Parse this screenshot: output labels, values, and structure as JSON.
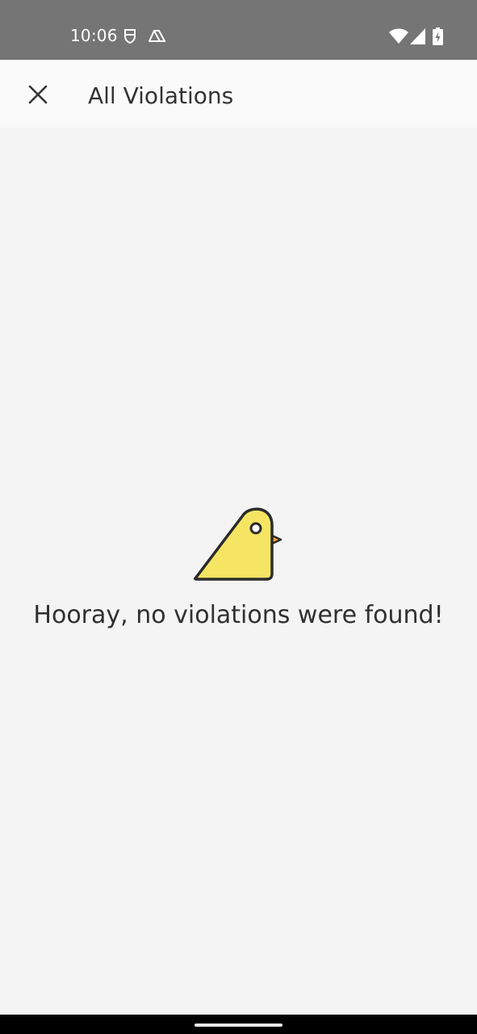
{
  "status_bar": {
    "time": "10:06",
    "notification_icons": [
      "shield-icon",
      "drive-icon"
    ],
    "system_icons": [
      "wifi-icon",
      "cellular-signal-icon",
      "battery-charging-icon"
    ]
  },
  "app_bar": {
    "close_icon": "close-icon",
    "title": "All Violations"
  },
  "empty_state": {
    "illustration": "bird-icon",
    "message": "Hooray, no violations were found!"
  },
  "colors": {
    "status_bar_bg": "#757575",
    "app_bar_bg": "#fafafa",
    "content_bg": "#f4f4f4",
    "bird_fill": "#f5e563",
    "beak": "#f3a73a"
  }
}
